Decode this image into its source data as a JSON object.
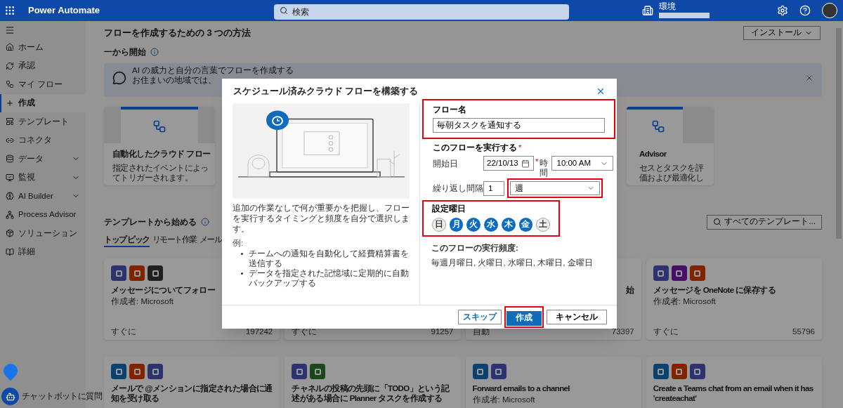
{
  "app": {
    "title": "Power Automate"
  },
  "search": {
    "placeholder": "検索"
  },
  "account": {
    "environment_label": "環境"
  },
  "sidebar": {
    "items": [
      {
        "label": "ホーム",
        "selected": false,
        "expandable": false
      },
      {
        "label": "承認",
        "selected": false,
        "expandable": false
      },
      {
        "label": "マイ フロー",
        "selected": false,
        "expandable": false
      },
      {
        "label": "作成",
        "selected": true,
        "expandable": false
      },
      {
        "label": "テンプレート",
        "selected": false,
        "expandable": false
      },
      {
        "label": "コネクタ",
        "selected": false,
        "expandable": false
      },
      {
        "label": "データ",
        "selected": false,
        "expandable": true
      },
      {
        "label": "監視",
        "selected": false,
        "expandable": true
      },
      {
        "label": "AI Builder",
        "selected": false,
        "expandable": true
      },
      {
        "label": "Process Advisor",
        "selected": false,
        "expandable": false
      },
      {
        "label": "ソリューション",
        "selected": false,
        "expandable": false
      },
      {
        "label": "詳細",
        "selected": false,
        "expandable": false
      }
    ]
  },
  "page": {
    "title": "フローを作成するための 3 つの方法",
    "install_button": "インストール",
    "from_scratch": {
      "heading": "一から開始"
    },
    "banner": {
      "title": "AI の威力と自分の言葉でフローを作成する",
      "text": "お住まいの地域では、"
    },
    "start_cards": [
      {
        "title": "自動化したクラウド フロー",
        "subtitle": "指定されたイベントによってトリガーされます。"
      },
      {
        "title": "Advisor",
        "subtitle": "セスとタスクを評価および最適化し"
      }
    ]
  },
  "templates": {
    "heading": "テンプレートから始める",
    "search_button": "すべてのテンプレート...",
    "tabs": [
      {
        "label": "トップ ピック",
        "selected": true
      },
      {
        "label": "リモート作業",
        "selected": false
      },
      {
        "label": "メール",
        "selected": false
      }
    ],
    "cards": [
      {
        "title": "メッセージについてフォロー",
        "author": "作成者: Microsoft",
        "trigger": "すぐに",
        "count": "197242",
        "apps": [
          {
            "color": "#2d3271"
          },
          {
            "color": "#822300"
          },
          {
            "color": "#1f1f1f"
          }
        ]
      },
      {
        "trigger": "すぐに",
        "count": "91257"
      },
      {
        "title": "始",
        "trigger": "自動",
        "count": "73397"
      },
      {
        "title": "メッセージを OneNote に保存する",
        "author": "作成者: Microsoft",
        "trigger": "すぐに",
        "count": "55796",
        "apps": [
          {
            "color": "#2d3271"
          },
          {
            "color": "#470f66"
          },
          {
            "color": "#822300"
          }
        ]
      },
      {
        "title": "メールで @メンションに指定された場合に通知を受け取る",
        "apps": [
          {
            "color": "#094171"
          },
          {
            "color": "#822300"
          },
          {
            "color": "#2d3271"
          }
        ]
      },
      {
        "title": "チャネルの投稿の先頭に「TODO」という記述がある場合に Planner タスクを作成する",
        "apps": [
          {
            "color": "#2d3271"
          },
          {
            "color": "#1d461c"
          }
        ]
      },
      {
        "title": "Forward emails to a channel",
        "author": "作成者: Microsoft",
        "apps": [
          {
            "color": "#094171"
          },
          {
            "color": "#2d3271"
          }
        ]
      },
      {
        "title": "Create a Teams chat from an email when it has 'createachat'",
        "apps": [
          {
            "color": "#094171"
          },
          {
            "color": "#822300"
          },
          {
            "color": "#2d3271"
          }
        ]
      }
    ]
  },
  "dialog": {
    "title": "スケジュール済みクラウド フローを構築する",
    "description": "追加の作業なしで何が重要かを把握し、フローを実行するタイミングと頻度を自分で選択します。",
    "examples_label": "例:",
    "examples": [
      "チームへの通知を自動化して経費精算書を送信する",
      "データを指定された記憶域に定期的に自動バックアップする"
    ],
    "flow_name": {
      "label": "フロー名",
      "value": "毎朝タスクを通知する"
    },
    "run_heading": "このフローを実行する",
    "required_mark": "*",
    "start_date": {
      "label": "開始日",
      "value": "22/10/13"
    },
    "time": {
      "label": "時間",
      "value": "10:00 AM"
    },
    "interval": {
      "label": "繰り返し間隔",
      "value": "1",
      "unit": "週"
    },
    "days": {
      "label": "設定曜日",
      "items": [
        {
          "label": "日",
          "selected": false
        },
        {
          "label": "月",
          "selected": true
        },
        {
          "label": "火",
          "selected": true
        },
        {
          "label": "水",
          "selected": true
        },
        {
          "label": "木",
          "selected": true
        },
        {
          "label": "金",
          "selected": true
        },
        {
          "label": "土",
          "selected": false
        }
      ]
    },
    "summary": {
      "label": "このフローの実行頻度:",
      "text": "毎週月曜日, 火曜日, 水曜日, 木曜日, 金曜日"
    },
    "buttons": {
      "skip": "スキップ",
      "create": "作成",
      "cancel": "キャンセル"
    }
  },
  "chatbot": {
    "label": "チャットボットに質問"
  }
}
